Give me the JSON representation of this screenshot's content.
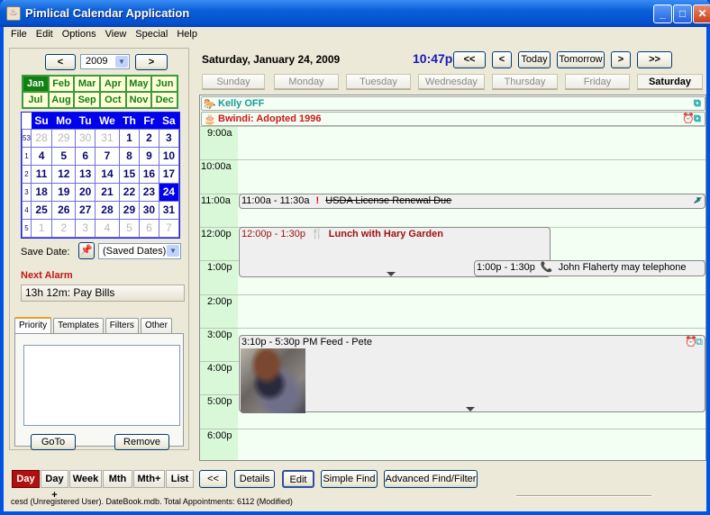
{
  "window": {
    "title": "Pimlical Calendar Application",
    "controls": {
      "minimize": "_",
      "maximize": "□",
      "close": "✕"
    }
  },
  "menu": [
    "File",
    "Edit",
    "Options",
    "View",
    "Special",
    "Help"
  ],
  "sidebar": {
    "prev_year": "<",
    "next_year": ">",
    "year": "2009",
    "months": [
      "Jan",
      "Feb",
      "Mar",
      "Apr",
      "May",
      "Jun",
      "Jul",
      "Aug",
      "Sep",
      "Oct",
      "Nov",
      "Dec"
    ],
    "selected_month": "Jan",
    "weekdays": [
      "Su",
      "Mo",
      "Tu",
      "We",
      "Th",
      "Fr",
      "Sa"
    ],
    "weeks": [
      {
        "num": "53",
        "days": [
          [
            "28",
            true
          ],
          [
            "29",
            true
          ],
          [
            "30",
            true
          ],
          [
            "31",
            true
          ],
          [
            "1",
            false
          ],
          [
            "2",
            false
          ],
          [
            "3",
            false
          ]
        ]
      },
      {
        "num": "1",
        "days": [
          [
            "4",
            false
          ],
          [
            "5",
            false
          ],
          [
            "6",
            false
          ],
          [
            "7",
            false
          ],
          [
            "8",
            false
          ],
          [
            "9",
            false
          ],
          [
            "10",
            false
          ]
        ]
      },
      {
        "num": "2",
        "days": [
          [
            "11",
            false
          ],
          [
            "12",
            false
          ],
          [
            "13",
            false
          ],
          [
            "14",
            false
          ],
          [
            "15",
            false
          ],
          [
            "16",
            false
          ],
          [
            "17",
            false
          ]
        ]
      },
      {
        "num": "3",
        "days": [
          [
            "18",
            false
          ],
          [
            "19",
            false
          ],
          [
            "20",
            false
          ],
          [
            "21",
            false
          ],
          [
            "22",
            false
          ],
          [
            "23",
            false
          ],
          [
            "24",
            false
          ]
        ]
      },
      {
        "num": "4",
        "days": [
          [
            "25",
            false
          ],
          [
            "26",
            false
          ],
          [
            "27",
            false
          ],
          [
            "28",
            false
          ],
          [
            "29",
            false
          ],
          [
            "30",
            false
          ],
          [
            "31",
            false
          ]
        ]
      },
      {
        "num": "5",
        "days": [
          [
            "1",
            true
          ],
          [
            "2",
            true
          ],
          [
            "3",
            true
          ],
          [
            "4",
            true
          ],
          [
            "5",
            true
          ],
          [
            "6",
            true
          ],
          [
            "7",
            true
          ]
        ]
      }
    ],
    "selected_day": "24",
    "save_date_label": "Save Date:",
    "saved_dates_value": "(Saved Dates)",
    "next_alarm_label": "Next Alarm",
    "next_alarm_value": "13h 12m:  Pay Bills",
    "tabs": [
      "Priority",
      "Templates",
      "Filters",
      "Other"
    ],
    "active_tab": "Priority",
    "goto_label": "GoTo",
    "remove_label": "Remove"
  },
  "header": {
    "date": "Saturday, January 24, 2009",
    "time": "10:47p",
    "nav": {
      "prev_week": "<<",
      "prev_day": "<",
      "today": "Today",
      "tomorrow": "Tomorrow",
      "next_day": ">",
      "next_week": ">>"
    },
    "days": [
      "Sunday",
      "Monday",
      "Tuesday",
      "Wednesday",
      "Thursday",
      "Friday",
      "Saturday"
    ],
    "active_day": "Saturday"
  },
  "dayview": {
    "allday": [
      {
        "title": "Kelly OFF",
        "color": "#1a9a9a",
        "icon": "horse-icon"
      },
      {
        "title": "Bwindi: Adopted 1996",
        "color": "#d01818",
        "icon": "cake-icon"
      }
    ],
    "hours": [
      "9:00a",
      "10:00a",
      "11:00a",
      "12:00p",
      "1:00p",
      "2:00p",
      "3:00p",
      "4:00p",
      "5:00p",
      "6:00p"
    ],
    "appointments": [
      {
        "time": "11:00a - 11:30a",
        "title": "USDA License Renewal Due",
        "priority": "!",
        "completed": true
      },
      {
        "time": "12:00p - 1:30p",
        "title": "Lunch with Hary Garden",
        "color": "#a01010"
      },
      {
        "time": "1:00p - 1:30p",
        "title": "John Flaherty may telephone"
      },
      {
        "time": "3:10p - 5:30p",
        "title": "PM Feed - Pete"
      }
    ]
  },
  "view_buttons": [
    "Day",
    "Day +",
    "Week",
    "Mth",
    "Mth+",
    "List"
  ],
  "active_view": "Day",
  "actions": {
    "back": "<<",
    "details": "Details",
    "edit": "Edit",
    "simple_find": "Simple Find",
    "advanced_find": "Advanced Find/Filter"
  },
  "status": "cesd (Unregistered User). DateBook.mdb. Total Appointments: 6112 (Modified)"
}
